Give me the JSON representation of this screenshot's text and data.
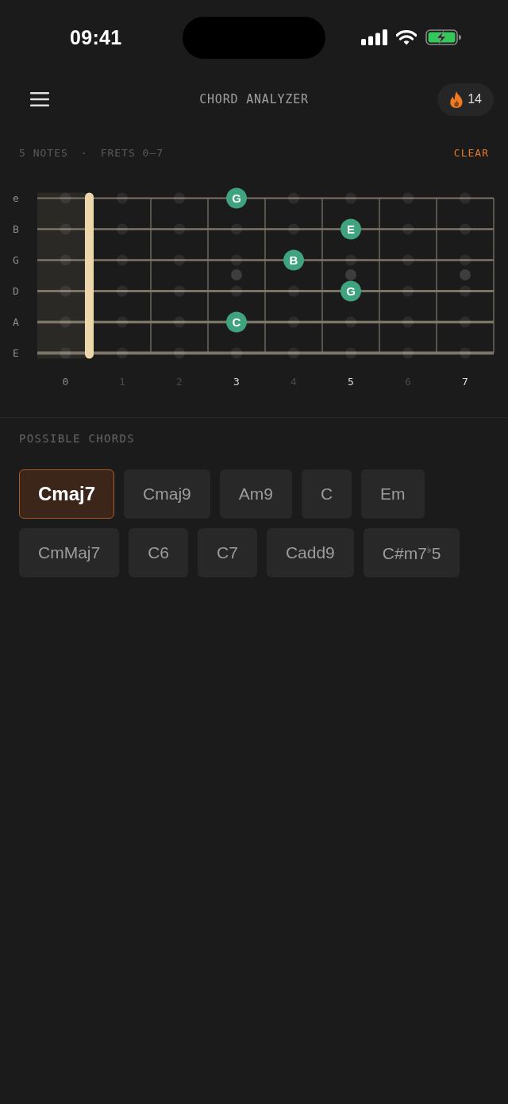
{
  "status_bar": {
    "time": "09:41"
  },
  "header": {
    "title": "CHORD ANALYZER",
    "streak": "14"
  },
  "summary": {
    "note_count": "5 NOTES",
    "separator": "·",
    "fret_range": "FRETS 0–7",
    "clear": "CLEAR"
  },
  "fretboard": {
    "strings": [
      {
        "label": "e",
        "frets": [
          {
            "selected": false
          },
          {
            "selected": false
          },
          {
            "selected": false
          },
          {
            "selected": true,
            "note": "G"
          },
          {
            "selected": false
          },
          {
            "selected": false
          },
          {
            "selected": false
          },
          {
            "selected": false
          }
        ]
      },
      {
        "label": "B",
        "frets": [
          {
            "selected": false
          },
          {
            "selected": false
          },
          {
            "selected": false
          },
          {
            "selected": false
          },
          {
            "selected": false
          },
          {
            "selected": true,
            "note": "E"
          },
          {
            "selected": false
          },
          {
            "selected": false
          }
        ]
      },
      {
        "label": "G",
        "frets": [
          {
            "selected": false
          },
          {
            "selected": false
          },
          {
            "selected": false
          },
          {
            "selected": false
          },
          {
            "selected": true,
            "note": "B"
          },
          {
            "selected": false
          },
          {
            "selected": false
          },
          {
            "selected": false
          }
        ]
      },
      {
        "label": "D",
        "frets": [
          {
            "selected": false
          },
          {
            "selected": false
          },
          {
            "selected": false
          },
          {
            "selected": false
          },
          {
            "selected": false
          },
          {
            "selected": true,
            "note": "G"
          },
          {
            "selected": false
          },
          {
            "selected": false
          }
        ]
      },
      {
        "label": "A",
        "frets": [
          {
            "selected": false
          },
          {
            "selected": false
          },
          {
            "selected": false
          },
          {
            "selected": true,
            "note": "C"
          },
          {
            "selected": false
          },
          {
            "selected": false
          },
          {
            "selected": false
          },
          {
            "selected": false
          }
        ]
      },
      {
        "label": "E",
        "frets": [
          {
            "selected": false
          },
          {
            "selected": false
          },
          {
            "selected": false
          },
          {
            "selected": false
          },
          {
            "selected": false
          },
          {
            "selected": false
          },
          {
            "selected": false
          },
          {
            "selected": false
          }
        ]
      }
    ],
    "fret_numbers": [
      {
        "label": "0",
        "kind": "open"
      },
      {
        "label": "1",
        "kind": "plain"
      },
      {
        "label": "2",
        "kind": "plain"
      },
      {
        "label": "3",
        "kind": "inlay"
      },
      {
        "label": "4",
        "kind": "plain"
      },
      {
        "label": "5",
        "kind": "inlay"
      },
      {
        "label": "6",
        "kind": "plain"
      },
      {
        "label": "7",
        "kind": "inlay"
      }
    ]
  },
  "chords": {
    "title": "POSSIBLE CHORDS",
    "items": [
      {
        "name": "Cmaj7",
        "selected": true
      },
      {
        "name": "Cmaj9",
        "selected": false
      },
      {
        "name": "Am9",
        "selected": false
      },
      {
        "name": "C",
        "selected": false
      },
      {
        "name": "Em",
        "selected": false
      },
      {
        "name": "CmMaj7",
        "selected": false
      },
      {
        "name": "C6",
        "selected": false
      },
      {
        "name": "C7",
        "selected": false
      },
      {
        "name": "Cadd9",
        "selected": false
      },
      {
        "name": "C#m7$^{♭}$5",
        "selected": false
      }
    ]
  }
}
